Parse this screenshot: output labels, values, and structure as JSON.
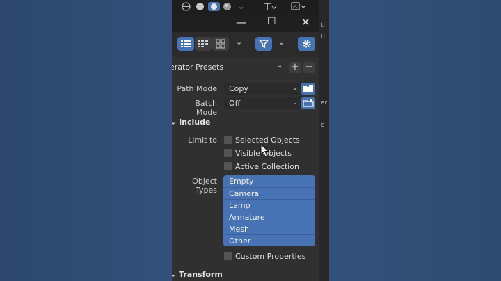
{
  "top_strip": {
    "icons": [
      "globe-icon",
      "solid-sphere-icon",
      "material-sphere-icon",
      "rendered-sphere-icon",
      "chevron-down-icon",
      "transform-icon",
      "image-icon"
    ]
  },
  "window_controls": {
    "minimize": "—",
    "maximize": "☐",
    "close": "✕"
  },
  "toolbar": {
    "view_buttons": [
      "list-vertical-icon",
      "list-horizontal-icon",
      "grid-thumbnails-icon"
    ],
    "filter_icon": "filter-icon",
    "settings_icon": "gear-icon"
  },
  "presets": {
    "label": "erator Presets",
    "add": "+",
    "remove": "−"
  },
  "path_mode": {
    "label": "Path Mode",
    "value": "Copy"
  },
  "batch_mode": {
    "label": "Batch Mode",
    "value": "Off"
  },
  "include": {
    "title": "Include",
    "limit_to_label": "Limit to",
    "limit_options": [
      {
        "label": "Selected Objects",
        "checked": false
      },
      {
        "label": "Visible Objects",
        "checked": false
      },
      {
        "label": "Active Collection",
        "checked": false
      }
    ],
    "object_types_label": "Object Types",
    "object_types": [
      "Empty",
      "Camera",
      "Lamp",
      "Armature",
      "Mesh",
      "Other"
    ],
    "custom_properties": {
      "label": "Custom Properties",
      "checked": false
    }
  },
  "transform": {
    "title": "Transform"
  },
  "side_panel": {
    "texts": [
      "ti",
      "er",
      "e"
    ]
  },
  "colors": {
    "accent": "#4772b3",
    "panel": "#303030",
    "background": "#2f4b70"
  }
}
